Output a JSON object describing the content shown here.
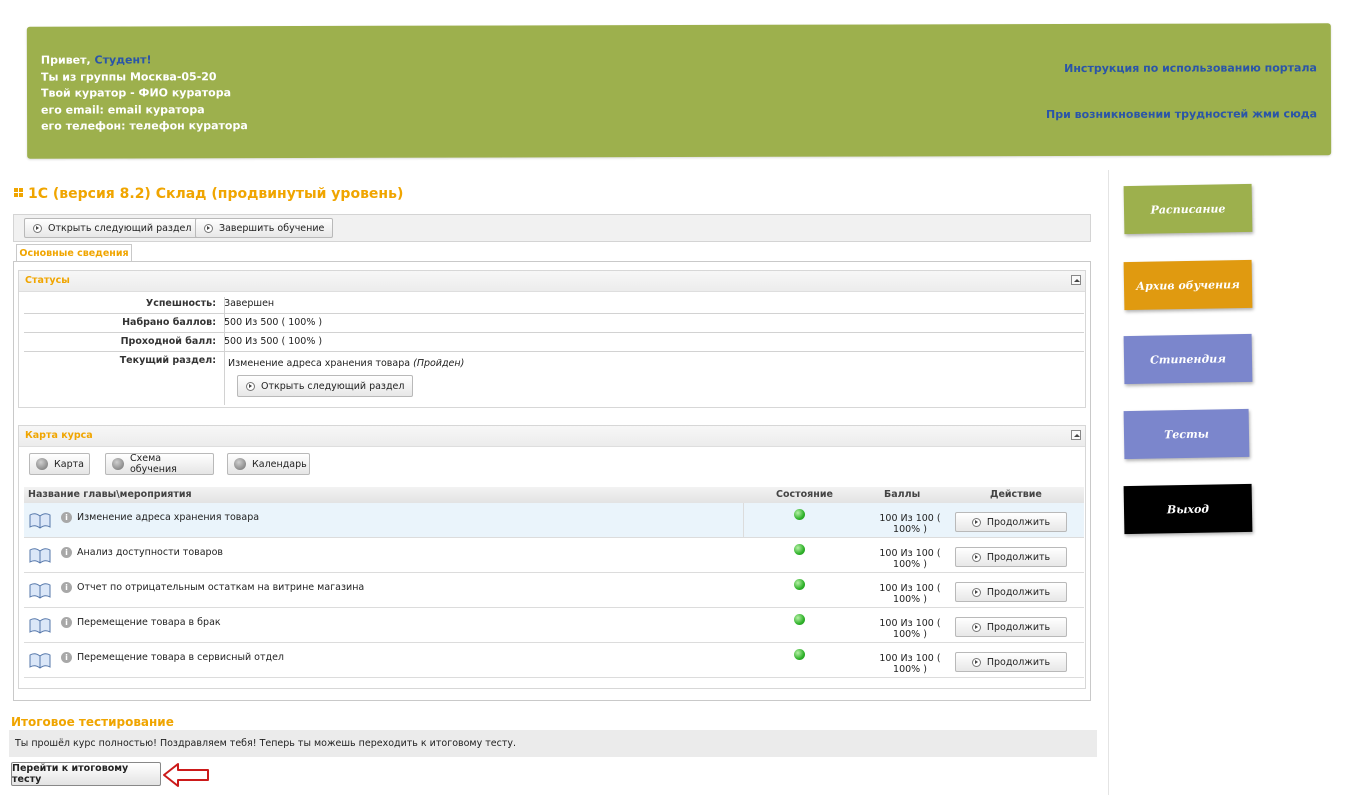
{
  "header": {
    "greeting_prefix": "Привет,",
    "user_name": "Студент!",
    "group_line": "Ты из группы Москва-05-20",
    "curator_line": "Твой куратор - ФИО куратора",
    "email_line": "его email:  email куратора",
    "phone_line": "его телефон:  телефон куратора",
    "link_instructions": "Инструкция по использованию портала",
    "link_help": "При возникновении трудностей жми сюда"
  },
  "course": {
    "title": "1С (версия 8.2) Склад (продвинутый уровень)"
  },
  "toolbar": {
    "open_next_label": "Открыть следующий раздел",
    "finish_label": "Завершить обучение"
  },
  "tabs": [
    {
      "label": "Основные сведения",
      "active": true
    }
  ],
  "statuses": {
    "title": "Статусы",
    "rows": [
      {
        "key": "Успешность:",
        "value": "Завершен"
      },
      {
        "key": "Набрано баллов:",
        "value": "500 Из 500 ( 100% )"
      },
      {
        "key": "Проходной балл:",
        "value": "500 Из 500 ( 100% )"
      },
      {
        "key": "Текущий раздел:",
        "value": "Изменение адреса хранения товара",
        "note": "(Пройден)"
      }
    ],
    "open_next_label": "Открыть следующий раздел"
  },
  "course_map": {
    "title": "Карта курса",
    "view_buttons": [
      "Карта",
      "Схема обучения",
      "Календарь"
    ],
    "columns": [
      "Название главы\\мероприятия",
      "Состояние",
      "Баллы",
      "Действие"
    ],
    "rows": [
      {
        "name": "Изменение адреса хранения товара",
        "score_line1": "100 Из 100 (",
        "score_line2": "100% )",
        "action": "Продолжить"
      },
      {
        "name": "Анализ доступности товаров",
        "score_line1": "100 Из 100 (",
        "score_line2": "100% )",
        "action": "Продолжить"
      },
      {
        "name": "Отчет по отрицательным остаткам на витрине магазина",
        "score_line1": "100 Из 100 (",
        "score_line2": "100% )",
        "action": "Продолжить"
      },
      {
        "name": "Перемещение товара в брак",
        "score_line1": "100 Из 100 (",
        "score_line2": "100% )",
        "action": "Продолжить"
      },
      {
        "name": "Перемещение товара в сервисный отдел",
        "score_line1": "100 Из 100 (",
        "score_line2": "100% )",
        "action": "Продолжить"
      }
    ]
  },
  "final_test": {
    "title": "Итоговое тестирование",
    "message": "Ты прошёл курс полностью! Поздравляем тебя! Теперь ты можешь переходить к итоговому тесту.",
    "button_label": "Перейти к итоговому тесту"
  },
  "nav": [
    {
      "label": "Расписание",
      "color": "#9db04d"
    },
    {
      "label": "Архив обучения",
      "color": "#e09a10"
    },
    {
      "label": "Стипендия",
      "color": "#7b86cc"
    },
    {
      "label": "Тесты",
      "color": "#7b86cc"
    },
    {
      "label": "Выход",
      "color": "#000000"
    }
  ],
  "colors": {
    "accent": "#f0a500",
    "header_bg": "#9db04d",
    "link": "#2a55a8"
  }
}
